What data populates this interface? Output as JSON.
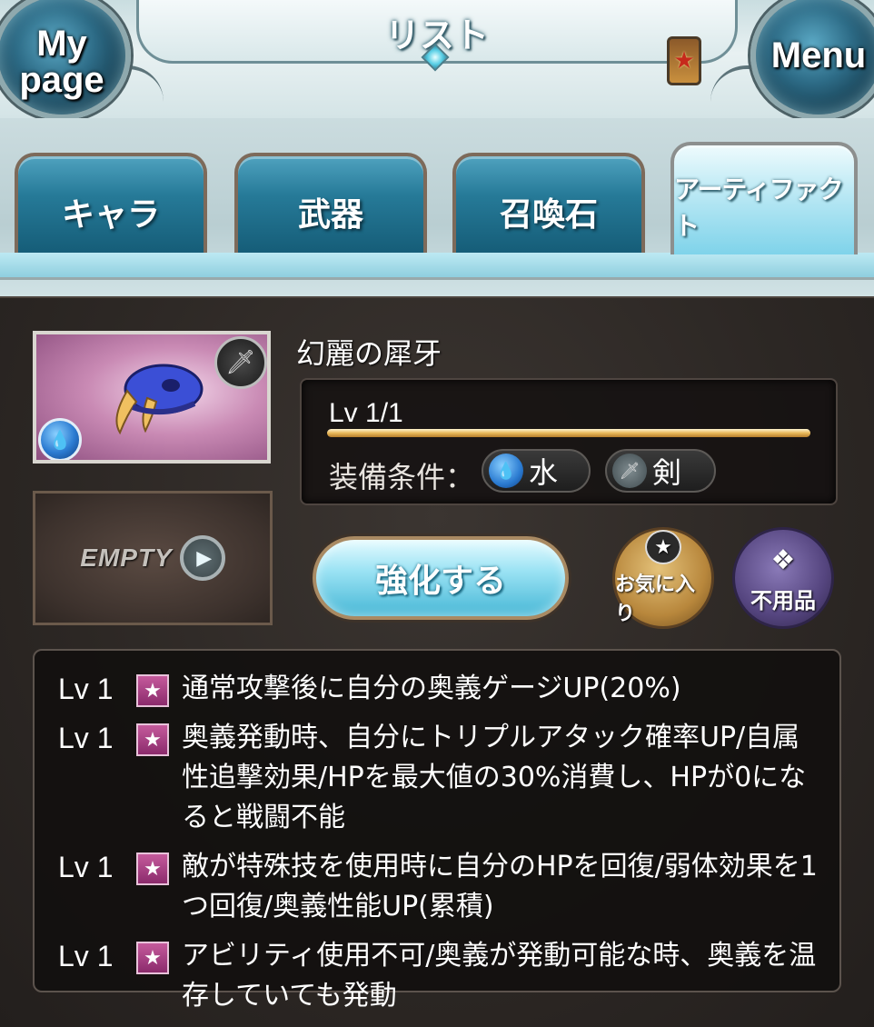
{
  "header": {
    "title": "リスト",
    "mypage_label": "My\npage",
    "menu_label": "Menu"
  },
  "tabs": [
    {
      "label": "キャラ",
      "active": false
    },
    {
      "label": "武器",
      "active": false
    },
    {
      "label": "召喚石",
      "active": false
    },
    {
      "label": "アーティファクト",
      "active": true
    }
  ],
  "item": {
    "name": "幻麗の犀牙",
    "element_icon": "water-icon",
    "weapon_icon": "sword-icon",
    "level_text": "Lv 1/1",
    "level_fill": 1.0,
    "equip_label": "装備条件：",
    "equip_element": "水",
    "equip_weapon": "剣"
  },
  "empty_slot": {
    "label": "EMPTY"
  },
  "actions": {
    "upgrade_label": "強化する",
    "favorite_label": "お気に入り",
    "junk_label": "不用品"
  },
  "skills": [
    {
      "level": "Lv 1",
      "text": "通常攻撃後に自分の奥義ゲージUP(20%)"
    },
    {
      "level": "Lv 1",
      "text": "奥義発動時、自分にトリプルアタック確率UP/自属性追撃効果/HPを最大値の30%消費し、HPが0になると戦闘不能"
    },
    {
      "level": "Lv 1",
      "text": "敵が特殊技を使用時に自分のHPを回復/弱体効果を1つ回復/奥義性能UP(累積)"
    },
    {
      "level": "Lv 1",
      "text": "アビリティ使用不可/奥義が発動可能な時、奥義を温存していても発動"
    }
  ],
  "colors": {
    "accent": "#4fa2bf",
    "level_bar": "#e8b85a",
    "skill_star": "#c55a9c"
  }
}
